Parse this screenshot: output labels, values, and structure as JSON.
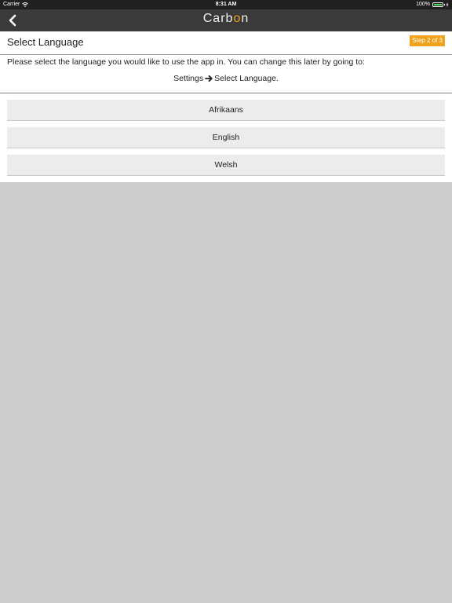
{
  "status_bar": {
    "carrier": "Carrier",
    "time": "8:31 AM",
    "battery": "100%"
  },
  "nav": {
    "brand_prefix": "Carb",
    "brand_accent": "o",
    "brand_suffix": "n",
    "accent_color": "#f0a21c"
  },
  "page": {
    "title": "Select Language",
    "step": "Step 2 of 3",
    "intro": "Please select the language you would like to use the app in. You can change this later by going to:",
    "path_from": "Settings",
    "path_to": "Select Language."
  },
  "languages": [
    "Afrikaans",
    "English",
    "Welsh"
  ]
}
